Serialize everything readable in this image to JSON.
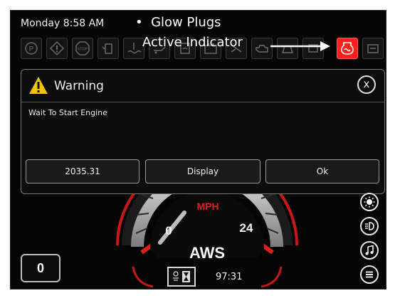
{
  "status_bar": {
    "clock": "Monday 8:58 AM"
  },
  "annotation": {
    "bullet": "•",
    "line1": "Glow Plugs",
    "line2": "Active Indicator"
  },
  "indicator_icons": [
    {
      "name": "parking-brake-icon",
      "glyph": "(P)",
      "active": false
    },
    {
      "name": "check-engine-icon",
      "glyph": "!",
      "active": false
    },
    {
      "name": "stop-icon",
      "glyph": "STOP",
      "active": false
    },
    {
      "name": "fuel-icon",
      "active": false
    },
    {
      "name": "coolant-temp-icon",
      "active": false
    },
    {
      "name": "oil-pressure-icon",
      "active": false
    },
    {
      "name": "water-in-fuel-icon",
      "active": false
    },
    {
      "name": "battery-icon",
      "active": false
    },
    {
      "name": "trans-icon",
      "active": false
    },
    {
      "name": "engine-icon",
      "active": false
    },
    {
      "name": "warning-light-icon",
      "active": false
    },
    {
      "name": "glow-plug-icon",
      "active": true
    },
    {
      "name": "wash-icon",
      "active": false
    }
  ],
  "dialog": {
    "title": "Warning",
    "close": "x",
    "message": "Wait To Start Engine",
    "buttons": [
      "2035.31",
      "Display",
      "Ok"
    ]
  },
  "gauge": {
    "unit": "MPH",
    "min_label": "0",
    "max_label": "24",
    "name": "AWS",
    "accent": "#e11d1d"
  },
  "odometer": {
    "value": "0"
  },
  "timer": {
    "value": "97:31"
  }
}
